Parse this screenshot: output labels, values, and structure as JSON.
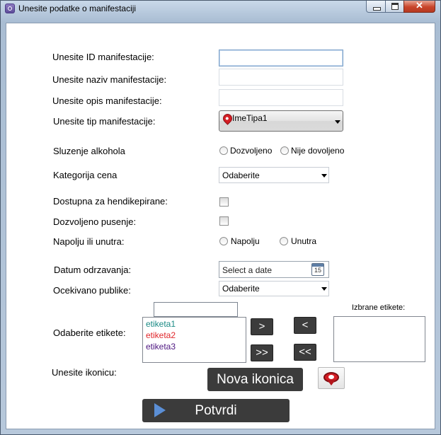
{
  "window": {
    "title": "Unesite podatke o manifestaciji",
    "close_glyph": "✕"
  },
  "labels": {
    "id": "Unesite ID manifestacije:",
    "naziv": "Unesite naziv manifestacije:",
    "opis": "Unesite opis manifestacije:",
    "tip": "Unesite tip manifestacije:",
    "alkohol": "Sluzenje alkohola",
    "cena": "Kategorija cena",
    "hendikep": "Dostupna za hendikepirane:",
    "pusenje": "Dozvoljeno pusenje:",
    "napolju": "Napolju ili unutra:",
    "datum": "Datum odrzavanja:",
    "publika": "Ocekivano publike:",
    "etikete": "Odaberite etikete:",
    "izbrane": "Izbrane etikete:",
    "ikonica": "Unesite ikonicu:"
  },
  "inputs": {
    "id_value": "",
    "naziv_value": "",
    "opis_value": "",
    "filter_value": ""
  },
  "tip_combo": {
    "selected": "ImeTipa1",
    "icon": "map-pin-icon"
  },
  "alkohol_options": [
    "Dozvoljeno",
    "Nije dovoljeno"
  ],
  "napolju_options": [
    "Napolju",
    "Unutra"
  ],
  "cena_combo": {
    "selected": "Odaberite"
  },
  "publika_combo": {
    "selected": "Odaberite"
  },
  "datepicker": {
    "placeholder": "Select a date",
    "calendar_day": "15"
  },
  "etikete": [
    {
      "name": "etiketa1",
      "color": "#1a8a84"
    },
    {
      "name": "etiketa2",
      "color": "#e0262a"
    },
    {
      "name": "etiketa3",
      "color": "#4d1680"
    }
  ],
  "buttons": {
    "add_one": ">",
    "remove_one": "<",
    "add_all": ">>",
    "remove_all": "<<",
    "nova_ikonica": "Nova ikonica",
    "potvrdi": "Potvrdi"
  }
}
